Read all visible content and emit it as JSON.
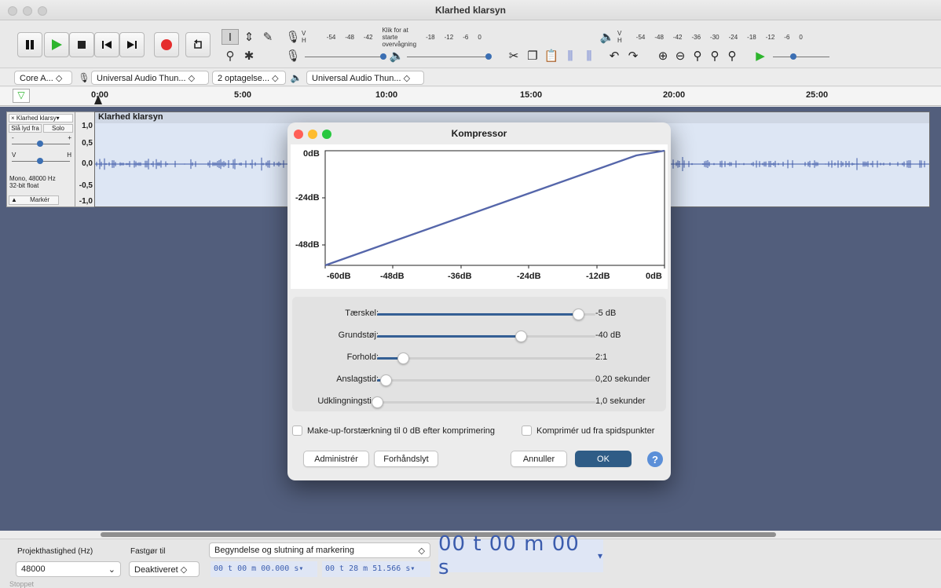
{
  "window": {
    "title": "Klarhed klarsyn"
  },
  "toolbar": {
    "meter_record_ticks": [
      "-54",
      "-48",
      "-42",
      "Klik for at starte overvågning",
      "-18",
      "-12",
      "-6",
      "0"
    ],
    "meter_play_ticks": [
      "-54",
      "-48",
      "-42",
      "-36",
      "-30",
      "-24",
      "-18",
      "-12",
      "-6",
      "0"
    ],
    "meter_lr": "V\nH"
  },
  "devicebar": {
    "host": "Core A...",
    "input_device": "Universal Audio Thun...",
    "channels": "2 optagelse...",
    "output_device": "Universal Audio Thun..."
  },
  "timeline": {
    "labels": [
      "0:00",
      "5:00",
      "10:00",
      "15:00",
      "20:00",
      "25:00"
    ]
  },
  "track": {
    "name": "Klarhed klarsy",
    "clip_name": "Klarhed klarsyn",
    "mute": "Slå lyd fra",
    "solo": "Solo",
    "gain_minus": "-",
    "gain_plus": "+",
    "pan_left": "V",
    "pan_right": "H",
    "info": "Mono, 48000 Hz\n32-bit float",
    "select": "Markér",
    "scale": [
      "1,0",
      "0,5",
      "0,0",
      "-0,5",
      "-1,0"
    ]
  },
  "dialog": {
    "title": "Kompressor",
    "graph": {
      "y_labels": [
        "0dB",
        "-24dB",
        "-48dB"
      ],
      "x_labels": [
        "-60dB",
        "-48dB",
        "-36dB",
        "-24dB",
        "-12dB",
        "0dB"
      ]
    },
    "controls": [
      {
        "label": "Tærskel:",
        "value": "-5 dB",
        "fraction": 0.92
      },
      {
        "label": "Grundstøj:",
        "value": "-40 dB",
        "fraction": 0.66
      },
      {
        "label": "Forhold:",
        "value": "2:1",
        "fraction": 0.12
      },
      {
        "label": "Anslagstid:",
        "value": "0,20 sekunder",
        "fraction": 0.04
      },
      {
        "label": "Udklingningstid:",
        "value": "1,0 sekunder",
        "fraction": 0.0
      }
    ],
    "makeup_label": "Make-up-forstærkning til 0 dB efter komprimering",
    "peaks_label": "Komprimér ud fra spidspunkter",
    "manage": "Administrér",
    "preview": "Forhåndslyt",
    "cancel": "Annuller",
    "ok": "OK",
    "help": "?"
  },
  "bottom": {
    "rate_label": "Projekthastighed (Hz)",
    "rate_value": "48000",
    "snap_label": "Fastgør til",
    "snap_value": "Deaktiveret",
    "selection_mode": "Begyndelse og slutning af markering",
    "sel_start": "00 t 00 m 00.000 s",
    "sel_end": "00 t 28 m 51.566 s",
    "position": "00 t 00 m 00 s",
    "status": "Stoppet"
  },
  "colors": {
    "track_bg": "#525e7c",
    "waveform": "#3f5aa8",
    "accent": "#2f5c86"
  }
}
